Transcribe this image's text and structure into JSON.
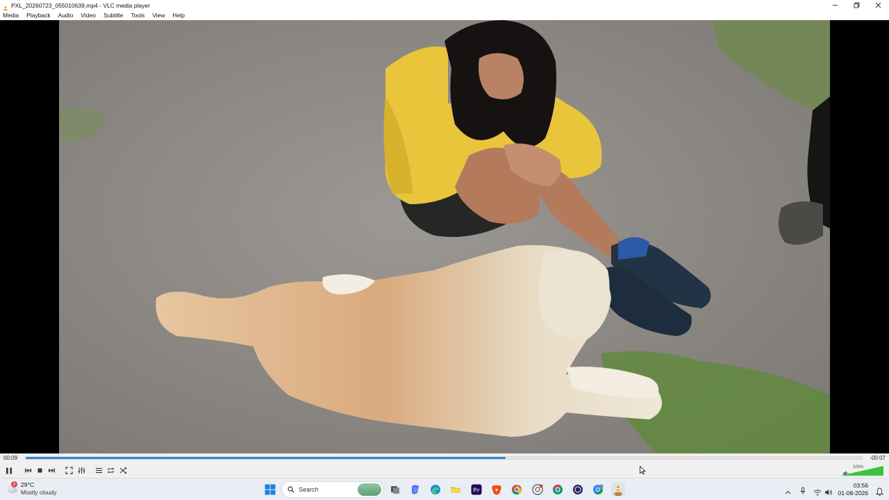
{
  "window": {
    "title": "PXL_20260723_055010639.mp4 - VLC media player",
    "controls": [
      "minimize",
      "restore",
      "close"
    ]
  },
  "menu": {
    "items": [
      "Media",
      "Playback",
      "Audio",
      "Video",
      "Subtitle",
      "Tools",
      "View",
      "Help"
    ]
  },
  "player": {
    "time_elapsed": "00:09",
    "time_remaining": "-00:07",
    "progress_fraction": 0.574,
    "volume_percent": "100%",
    "volume_fraction": 1.0,
    "buttons": [
      "pause",
      "previous",
      "stop",
      "next",
      "fullscreen",
      "extended-settings",
      "playlist",
      "loop",
      "shuffle"
    ]
  },
  "taskbar": {
    "weather": {
      "temperature": "29°C",
      "condition": "Mostly cloudy",
      "badge": "2"
    },
    "search": {
      "placeholder": "Search"
    },
    "apps": [
      "start",
      "search",
      "task-view",
      "copilot",
      "edge",
      "file-explorer",
      "premiere-pro",
      "brave",
      "chrome",
      "chrome-profile",
      "chrome-alt",
      "obs",
      "chrome-dev",
      "vlc"
    ],
    "clock": {
      "time": "03:56",
      "date": "01-08-2026"
    }
  },
  "colors": {
    "accent": "#2f86d6",
    "vlc_orange": "#f08c00",
    "volume_green": "#3cc43c"
  }
}
